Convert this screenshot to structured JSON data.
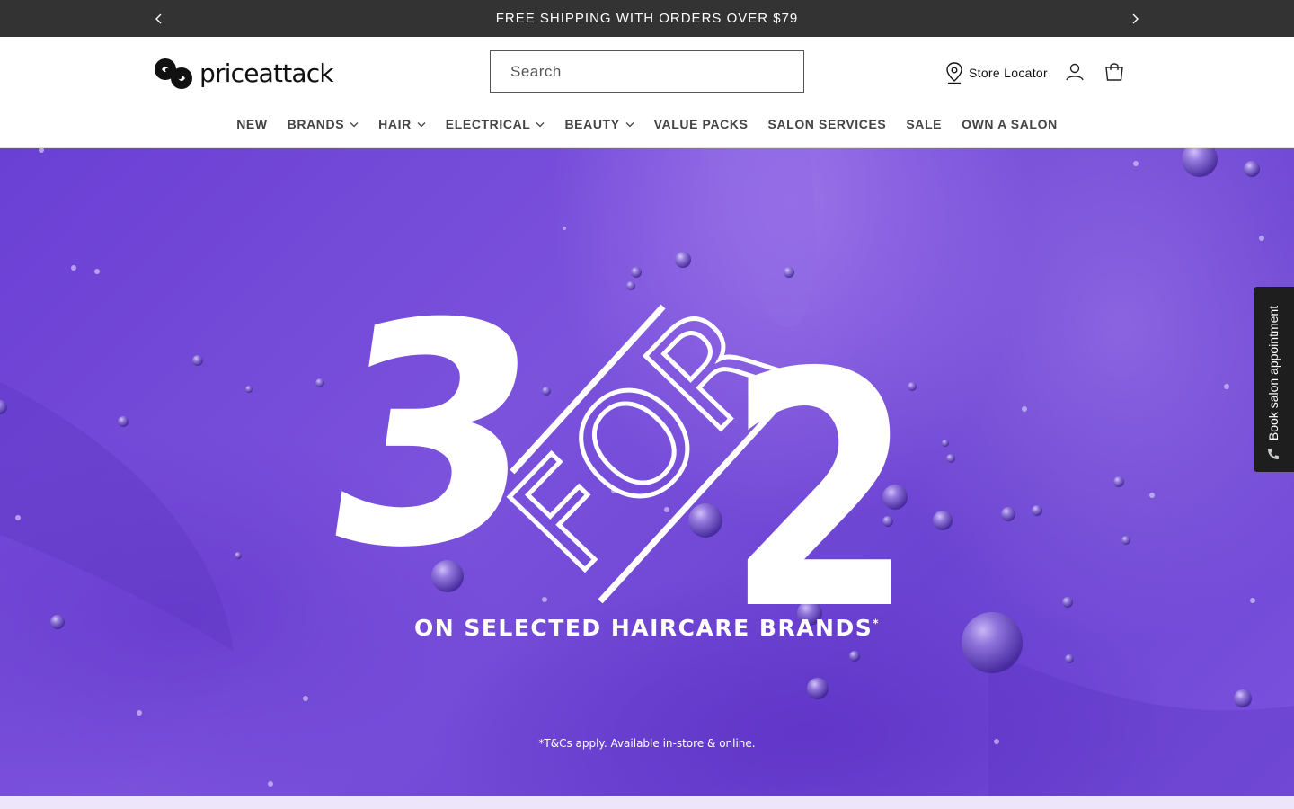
{
  "announcement": {
    "message": "FREE SHIPPING WITH ORDERS OVER $79",
    "prev_icon": "chevron-left-icon",
    "next_icon": "chevron-right-icon"
  },
  "header": {
    "logo_text": "priceattack",
    "search": {
      "placeholder": "Search",
      "value": ""
    },
    "store_locator_label": "Store Locator",
    "icons": [
      "map-pin-icon",
      "account-icon",
      "cart-icon"
    ]
  },
  "nav": {
    "items": [
      {
        "label": "NEW",
        "dropdown": false
      },
      {
        "label": "BRANDS",
        "dropdown": true
      },
      {
        "label": "HAIR",
        "dropdown": true
      },
      {
        "label": "ELECTRICAL",
        "dropdown": true
      },
      {
        "label": "BEAUTY",
        "dropdown": true
      },
      {
        "label": "VALUE PACKS",
        "dropdown": false
      },
      {
        "label": "SALON SERVICES",
        "dropdown": false
      },
      {
        "label": "SALE",
        "dropdown": false
      },
      {
        "label": "OWN A SALON",
        "dropdown": false
      }
    ]
  },
  "hero": {
    "num_left": "3",
    "word_mid": "FOR",
    "num_right": "2",
    "subline": "ON SELECTED HAIRCARE BRANDS",
    "subline_mark": "*",
    "tcs": "*T&Cs apply. Available in-store & online.",
    "background_color": "#7048d8"
  },
  "side_tab": {
    "label": "Book salon appointment",
    "icon": "phone-icon"
  },
  "colors": {
    "announcement_bg": "#333333",
    "hero_purple": "#7048d8",
    "side_tab_bg": "#1e1e1e"
  }
}
